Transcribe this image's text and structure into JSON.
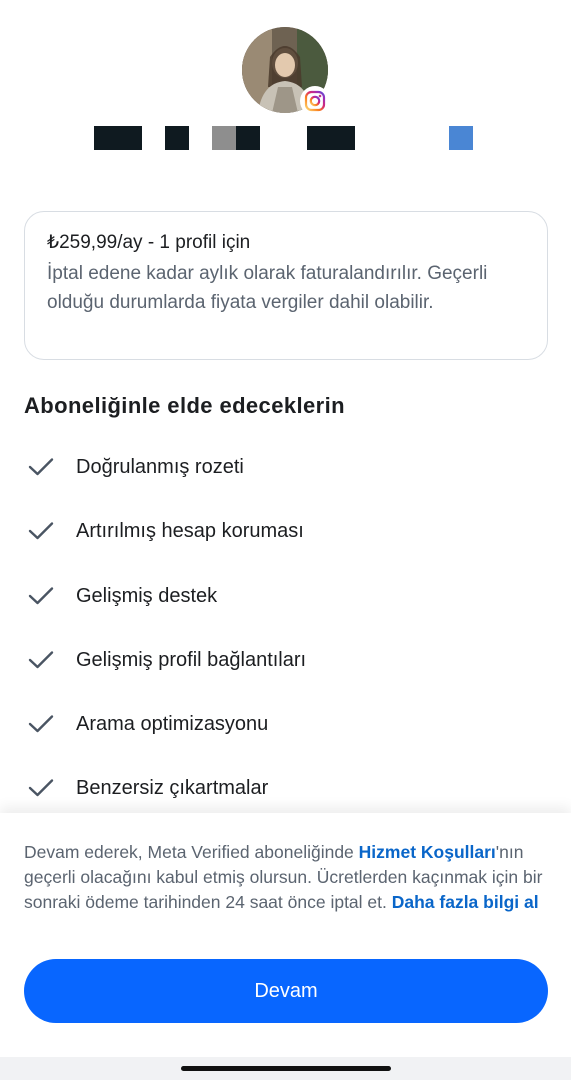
{
  "profile": {
    "avatar_icon": "profile-photo",
    "badge_icon": "instagram-icon",
    "name_redacted": true,
    "colors": {
      "redaction": "#0f1a20",
      "redaction_gray": "#8e8e8e",
      "redaction_blue": "#4a86d4"
    }
  },
  "price_card": {
    "title": "₺259,99/ay - 1 profil için",
    "description": "İptal edene kadar aylık olarak faturalandırılır. Geçerli olduğu durumlarda fiyata vergiler dahil olabilir."
  },
  "benefits": {
    "heading": "Aboneliğinle elde edeceklerin",
    "items": [
      {
        "label": "Doğrulanmış rozeti",
        "icon": "check-icon"
      },
      {
        "label": "Artırılmış hesap koruması",
        "icon": "check-icon"
      },
      {
        "label": "Gelişmiş destek",
        "icon": "check-icon"
      },
      {
        "label": "Gelişmiş profil bağlantıları",
        "icon": "check-icon"
      },
      {
        "label": "Arama optimizasyonu",
        "icon": "check-icon"
      },
      {
        "label": "Benzersiz çıkartmalar",
        "icon": "check-icon"
      }
    ]
  },
  "footer": {
    "terms_prefix": "Devam ederek, Meta Verified aboneliğinde ",
    "terms_link": "Hizmet Koşulları",
    "terms_middle": "'nın geçerli olacağını kabul etmiş olursun. Ücretlerden kaçınmak için bir sonraki ödeme tarihinden 24 saat önce iptal et. ",
    "learn_more_link": "Daha fazla bilgi al",
    "continue_label": "Devam"
  },
  "colors": {
    "primary_button": "#0866ff",
    "link": "#0a66c9",
    "text_primary": "#1c1e21",
    "text_secondary": "#5b6470"
  }
}
